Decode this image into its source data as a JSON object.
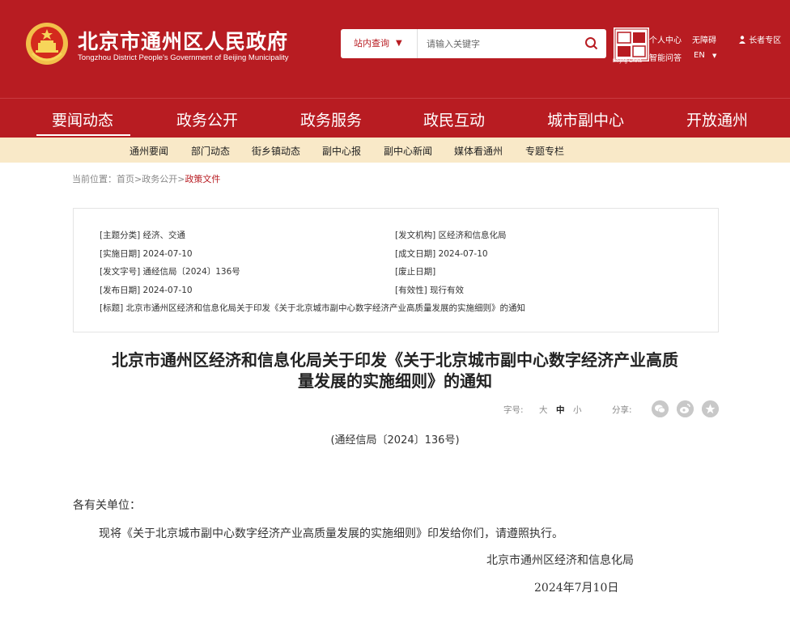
{
  "header": {
    "title": "北京市通州区人民政府",
    "subtitle": "Tongzhou District People's Government of Beijing Municipality",
    "search": {
      "scope": "站内查询",
      "placeholder": "请输入关键字"
    },
    "links": {
      "personal_center": "个人中心",
      "accessibility": "无障碍",
      "smart_qa": "智能问答",
      "language": "EN",
      "elderly": "长者专区"
    },
    "capital_logo_sub": "Beijing-China"
  },
  "nav": [
    "要闻动态",
    "政务公开",
    "政务服务",
    "政民互动",
    "城市副中心",
    "开放通州"
  ],
  "subnav": [
    "通州要闻",
    "部门动态",
    "街乡镇动态",
    "副中心报",
    "副中心新闻",
    "媒体看通州",
    "专题专栏"
  ],
  "breadcrumb": {
    "label": "当前位置：",
    "home": "首页",
    "sep": ">",
    "section": "政务公开",
    "current": "政策文件"
  },
  "meta": {
    "topic": "[主题分类] 经济、交通",
    "issuer": "[发文机构] 区经济和信息化局",
    "effective_date": "[实施日期] 2024-07-10",
    "written_date": "[成文日期] 2024-07-10",
    "doc_no": "[发文字号] 通经信局〔2024〕136号",
    "abolish_date": "[废止日期]",
    "publish_date": "[发布日期] 2024-07-10",
    "validity": "[有效性] 现行有效",
    "title": "[标题] 北京市通州区经济和信息化局关于印发《关于北京城市副中心数字经济产业高质量发展的实施细则》的通知"
  },
  "article": {
    "title_line1": "北京市通州区经济和信息化局关于印发《关于北京城市副中心数字经济产业高质",
    "title_line2": "量发展的实施细则》的通知",
    "font_label": "字号:",
    "font_large": "大",
    "font_medium": "中",
    "font_small": "小",
    "share_label": "分享:",
    "doc_number": "(通经信局〔2024〕136号)",
    "greeting": "各有关单位：",
    "body": "现将《关于北京城市副中心数字经济产业高质量发展的实施细则》印发给你们，请遵照执行。",
    "signer": "北京市通州区经济和信息化局",
    "date": "2024年7月10日"
  },
  "colors": {
    "brand_red": "#b81c22",
    "subnav_bg": "#f9e9c8",
    "emblem_gold": "#f2c04a"
  },
  "icons": [
    "national-emblem-icon",
    "search-icon",
    "capital-logo-icon",
    "person-icon",
    "wechat-icon",
    "weibo-icon",
    "star-icon"
  ]
}
